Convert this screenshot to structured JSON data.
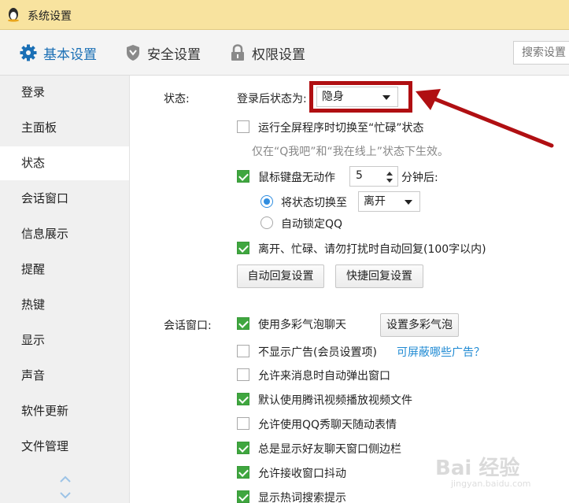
{
  "window": {
    "title": "系统设置"
  },
  "toolbar": {
    "tabs": [
      {
        "label": "基本设置",
        "icon": "gear-icon",
        "active": true
      },
      {
        "label": "安全设置",
        "icon": "shield-icon",
        "active": false
      },
      {
        "label": "权限设置",
        "icon": "lock-icon",
        "active": false
      }
    ],
    "search_placeholder": "搜索设置"
  },
  "sidebar": {
    "items": [
      {
        "label": "登录"
      },
      {
        "label": "主面板"
      },
      {
        "label": "状态",
        "active": true
      },
      {
        "label": "会话窗口"
      },
      {
        "label": "信息展示"
      },
      {
        "label": "提醒"
      },
      {
        "label": "热键"
      },
      {
        "label": "显示"
      },
      {
        "label": "声音"
      },
      {
        "label": "软件更新"
      },
      {
        "label": "文件管理"
      }
    ]
  },
  "status_section": {
    "label": "状态:",
    "login_status_label": "登录后状态为:",
    "login_status_value": "隐身",
    "fullscreen_busy": {
      "label": "运行全屏程序时切换至“忙碌”状态",
      "checked": false
    },
    "fullscreen_hint": "仅在“Q我吧”和“我在线上”状态下生效。",
    "idle": {
      "label": "鼠标键盘无动作",
      "checked": true,
      "minutes": "5",
      "suffix": "分钟后:"
    },
    "idle_switch": {
      "label": "将状态切换至",
      "selected": true,
      "value": "离开"
    },
    "idle_lock": {
      "label": "自动锁定QQ",
      "selected": false
    },
    "auto_reply": {
      "label": "离开、忙碌、请勿打扰时自动回复(100字以内)",
      "checked": true
    },
    "buttons": {
      "auto_reply": "自动回复设置",
      "quick_reply": "快捷回复设置"
    }
  },
  "chat_section": {
    "label": "会话窗口:",
    "items": [
      {
        "label": "使用多彩气泡聊天",
        "checked": true
      },
      {
        "label": "不显示广告(会员设置项)",
        "checked": false
      },
      {
        "label": "允许来消息时自动弹出窗口",
        "checked": false
      },
      {
        "label": "默认使用腾讯视频播放视频文件",
        "checked": true
      },
      {
        "label": "允许使用QQ秀聊天随动表情",
        "checked": false
      },
      {
        "label": "总是显示好友聊天窗口侧边栏",
        "checked": true
      },
      {
        "label": "允许接收窗口抖动",
        "checked": true
      },
      {
        "label": "显示热词搜索提示",
        "checked": true
      }
    ],
    "bubble_button": "设置多彩气泡",
    "ads_link": "可屏蔽哪些广告？"
  },
  "watermark": {
    "brand": "Bai 经验",
    "url": "jingyan.baidu.com"
  },
  "colors": {
    "accent": "#1a6fb5",
    "checkbox_on": "#3fa63f",
    "annotation": "#b00f12",
    "titlebar": "#f8e39f"
  }
}
